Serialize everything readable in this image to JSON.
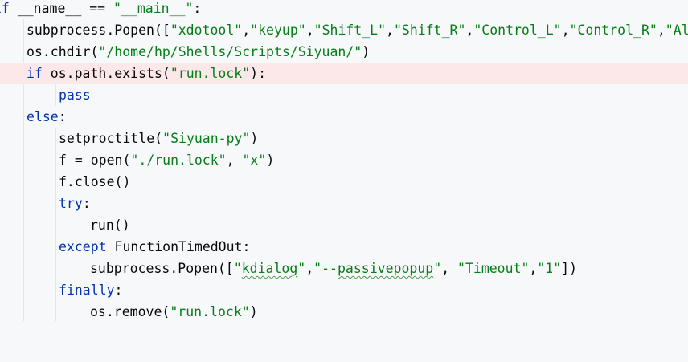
{
  "editor": {
    "lines": [
      {
        "tokens": [
          {
            "t": "if",
            "c": "kw"
          },
          {
            "t": " "
          },
          {
            "t": "__name__",
            "c": "op"
          },
          {
            "t": " == "
          },
          {
            "t": "\"__main__\"",
            "c": "str"
          },
          {
            "t": ":"
          }
        ]
      },
      {
        "tokens": [
          {
            "t": "subprocess.Popen(["
          },
          {
            "t": "\"xdotool\"",
            "c": "str"
          },
          {
            "t": ","
          },
          {
            "t": "\"keyup\"",
            "c": "str"
          },
          {
            "t": ","
          },
          {
            "t": "\"Shift_L\"",
            "c": "str"
          },
          {
            "t": ","
          },
          {
            "t": "\"Shift_R\"",
            "c": "str"
          },
          {
            "t": ","
          },
          {
            "t": "\"Control_L\"",
            "c": "str"
          },
          {
            "t": ","
          },
          {
            "t": "\"Control_R\"",
            "c": "str"
          },
          {
            "t": ","
          },
          {
            "t": "\"Al",
            "c": "str"
          }
        ]
      },
      {
        "tokens": [
          {
            "t": "os.chdir("
          },
          {
            "t": "\"/home/hp/Shells/Scripts/Siyuan/\"",
            "c": "str"
          },
          {
            "t": ")"
          }
        ]
      },
      {
        "tokens": [
          {
            "t": "if",
            "c": "kw"
          },
          {
            "t": " os.path.exists("
          },
          {
            "t": "\"run.lock\"",
            "c": "str"
          },
          {
            "t": "):"
          }
        ]
      },
      {
        "tokens": [
          {
            "t": "pass",
            "c": "kw"
          }
        ]
      },
      {
        "tokens": [
          {
            "t": "else",
            "c": "kw"
          },
          {
            "t": ":"
          }
        ]
      },
      {
        "tokens": [
          {
            "t": "setproctitle("
          },
          {
            "t": "\"Siyuan-py\"",
            "c": "str"
          },
          {
            "t": ")"
          }
        ]
      },
      {
        "tokens": [
          {
            "t": "f = open("
          },
          {
            "t": "\"./run.lock\"",
            "c": "str"
          },
          {
            "t": ", "
          },
          {
            "t": "\"x\"",
            "c": "str"
          },
          {
            "t": ")"
          }
        ]
      },
      {
        "tokens": [
          {
            "t": "f.close()"
          }
        ]
      },
      {
        "tokens": [
          {
            "t": "try",
            "c": "kw"
          },
          {
            "t": ":"
          }
        ]
      },
      {
        "tokens": [
          {
            "t": "run()"
          }
        ]
      },
      {
        "tokens": [
          {
            "t": "except",
            "c": "kw"
          },
          {
            "t": " FunctionTimedOut:"
          }
        ]
      },
      {
        "tokens": [
          {
            "t": "subprocess.Popen(["
          },
          {
            "t": "\"",
            "c": "str"
          },
          {
            "t": "kdialog",
            "c": "str typo"
          },
          {
            "t": "\"",
            "c": "str"
          },
          {
            "t": ","
          },
          {
            "t": "\"--",
            "c": "str"
          },
          {
            "t": "passivepopup",
            "c": "str typo"
          },
          {
            "t": "\"",
            "c": "str"
          },
          {
            "t": ", "
          },
          {
            "t": "\"Timeout\"",
            "c": "str"
          },
          {
            "t": ","
          },
          {
            "t": "\"1\"",
            "c": "str"
          },
          {
            "t": "])"
          }
        ]
      },
      {
        "tokens": [
          {
            "t": "finally",
            "c": "kw"
          },
          {
            "t": ":"
          }
        ]
      },
      {
        "tokens": [
          {
            "t": "os.remove("
          },
          {
            "t": "\"run.lock\"",
            "c": "str"
          },
          {
            "t": ")"
          }
        ]
      }
    ]
  }
}
